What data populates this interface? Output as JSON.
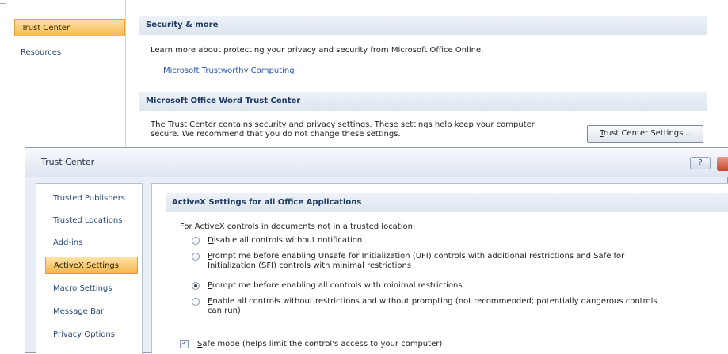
{
  "options_window": {
    "nav": [
      {
        "label": "Trust Center",
        "selected": true
      },
      {
        "label": "Resources",
        "selected": false
      }
    ],
    "security_section": {
      "header": "Security & more",
      "text": "Learn more about protecting your privacy and security from Microsoft Office Online.",
      "link": "Microsoft Trustworthy Computing"
    },
    "trust_center_section": {
      "header": "Microsoft Office Word Trust Center",
      "text_line1": "The Trust Center contains security and privacy settings. These settings help keep your computer",
      "text_line2": "secure. We recommend that you do not change these settings.",
      "button_accel": "T",
      "button_rest": "rust Center Settings..."
    }
  },
  "dialog": {
    "title": "Trust Center",
    "help_glyph": "?",
    "nav": [
      {
        "label": "Trusted Publishers",
        "selected": false
      },
      {
        "label": "Trusted Locations",
        "selected": false
      },
      {
        "label": "Add-ins",
        "selected": false
      },
      {
        "label": "ActiveX Settings",
        "selected": true
      },
      {
        "label": "Macro Settings",
        "selected": false
      },
      {
        "label": "Message Bar",
        "selected": false
      },
      {
        "label": "Privacy Options",
        "selected": false
      }
    ],
    "activex": {
      "header": "ActiveX Settings for all Office Applications",
      "intro": "For ActiveX controls in documents not in a trusted location:",
      "options": [
        {
          "accel": "D",
          "rest": "isable all controls without notification",
          "line2": "",
          "checked": false
        },
        {
          "accel": "P",
          "rest": "rompt me before enabling Unsafe for Initialization (UFI) controls with additional restrictions and Safe for",
          "line2": "Initialization (SFI) controls with minimal restrictions",
          "checked": false
        },
        {
          "accel": "P",
          "rest": "rompt me before enabling all controls with minimal restrictions",
          "line2": "",
          "checked": true
        },
        {
          "accel": "E",
          "rest": "nable all controls without restrictions and without prompting (not recommended; potentially dangerous controls",
          "line2": "can run)",
          "checked": false
        }
      ],
      "safe_mode": {
        "accel": "S",
        "rest": "afe mode (helps limit the control's access to your computer)",
        "checked": true,
        "check_glyph": "✓"
      }
    }
  }
}
